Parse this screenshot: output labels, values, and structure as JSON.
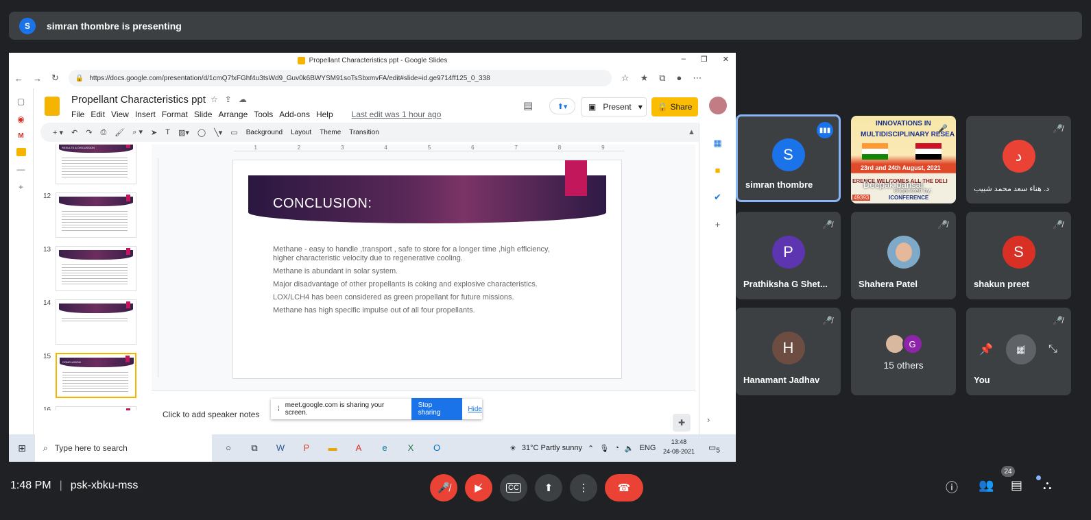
{
  "banner": {
    "avatar_letter": "S",
    "text": "simran thombre is presenting"
  },
  "window": {
    "title": "Propellant Characteristics ppt - Google Slides",
    "controls": [
      "–",
      "❐",
      "✕"
    ]
  },
  "browser": {
    "url": "https://docs.google.com/presentation/d/1cmQ7fxFGhf4u3tsWd9_Guv0k6BWYSM91soTsSbxmvFA/edit#slide=id.ge9714ff125_0_338"
  },
  "slides_app": {
    "doc_title": "Propellant Characteristics ppt",
    "menu": [
      "File",
      "Edit",
      "View",
      "Insert",
      "Format",
      "Slide",
      "Arrange",
      "Tools",
      "Add-ons",
      "Help"
    ],
    "last_edit": "Last edit was 1 hour ago",
    "present_label": "Present",
    "share_label": "Share",
    "toolbar_labels": [
      "Background",
      "Layout",
      "Theme",
      "Transition"
    ],
    "ruler_ticks": [
      "1",
      "2",
      "3",
      "4",
      "5",
      "6",
      "7",
      "8",
      "9"
    ],
    "filmstrip": [
      {
        "num": "",
        "heading": "RESULTS & DISCUSSION"
      },
      {
        "num": "12",
        "heading": ""
      },
      {
        "num": "13",
        "heading": ""
      },
      {
        "num": "14",
        "heading": ""
      },
      {
        "num": "15",
        "heading": "CONCLUSION"
      },
      {
        "num": "16",
        "heading": ""
      }
    ],
    "slide": {
      "title": "CONCLUSION:",
      "bullets": [
        "Methane - easy to handle ,transport , safe to store for a longer time ,high efficiency, higher  characteristic velocity due to regenerative cooling.",
        "Methane is abundant in solar system.",
        "Major disadvantage of other propellants is coking and explosive characteristics.",
        "LOX/LCH4 has been considered as green propellant for future missions.",
        "Methane has high specific impulse out of all four propellants."
      ]
    },
    "speaker_notes": "Click to add speaker notes",
    "share_notice": {
      "text": "meet.google.com is sharing your screen.",
      "stop_label": "Stop sharing",
      "hide_label": "Hide"
    }
  },
  "taskbar": {
    "search_placeholder": "Type here to search",
    "weather": "31°C  Partly sunny",
    "lang": "ENG",
    "time": "13:48",
    "date": "24-08-2021",
    "notif_count": "5"
  },
  "tiles": [
    {
      "name": "simran thombre",
      "letter": "S",
      "color": "#1a73e8"
    },
    {
      "name": "Deepak bansal",
      "conf": {
        "t1": "INNOVATIONS IN",
        "t2": "MULTIDISCIPLINARY RESEA",
        "t3": "23rd and 24th August, 2021",
        "t4": "ERENCE WELCOMES ALL THE DELI",
        "t5": "ICONFERENCE",
        "t6": "49393",
        "organized": "Organized by:"
      }
    },
    {
      "name": "د. هناء سعد محمد شبيب",
      "letter": "د",
      "color": "#ea4335"
    },
    {
      "name": "Prathiksha G Shet...",
      "letter": "P",
      "color": "#5e35b1"
    },
    {
      "name": "Shahera Patel",
      "letter": "",
      "color": "#7ea9c9"
    },
    {
      "name": "shakun preet",
      "letter": "S",
      "color": "#d93025"
    },
    {
      "name": "Hanamant Jadhav",
      "letter": "H",
      "color": "#6d4c41"
    },
    {
      "others_label": "15 others",
      "letter": "G"
    },
    {
      "name": "You"
    }
  ],
  "bottom": {
    "time": "1:48 PM",
    "code": "psk-xbku-mss",
    "people_count": "24"
  }
}
